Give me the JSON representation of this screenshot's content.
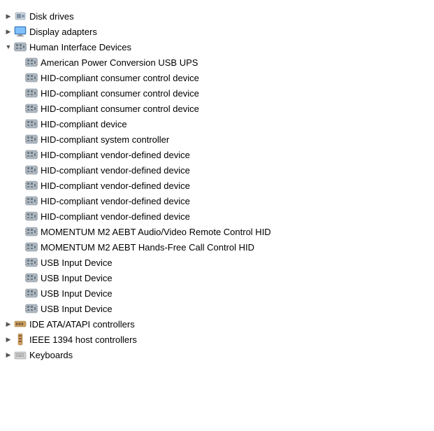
{
  "tree": {
    "items": [
      {
        "id": "disk-drives",
        "label": "Disk drives",
        "level": 0,
        "arrow": "right",
        "icon": "disk"
      },
      {
        "id": "display-adapters",
        "label": "Display adapters",
        "level": 0,
        "arrow": "right",
        "icon": "display"
      },
      {
        "id": "human-interface-devices",
        "label": "Human Interface Devices",
        "level": 0,
        "arrow": "down",
        "icon": "hid"
      },
      {
        "id": "apc-ups",
        "label": "American Power Conversion USB UPS",
        "level": 1,
        "arrow": "none",
        "icon": "hid"
      },
      {
        "id": "hid-consumer-1",
        "label": "HID-compliant consumer control device",
        "level": 1,
        "arrow": "none",
        "icon": "hid"
      },
      {
        "id": "hid-consumer-2",
        "label": "HID-compliant consumer control device",
        "level": 1,
        "arrow": "none",
        "icon": "hid"
      },
      {
        "id": "hid-consumer-3",
        "label": "HID-compliant consumer control device",
        "level": 1,
        "arrow": "none",
        "icon": "hid"
      },
      {
        "id": "hid-device",
        "label": "HID-compliant device",
        "level": 1,
        "arrow": "none",
        "icon": "hid"
      },
      {
        "id": "hid-system-controller",
        "label": "HID-compliant system controller",
        "level": 1,
        "arrow": "none",
        "icon": "hid"
      },
      {
        "id": "hid-vendor-1",
        "label": "HID-compliant vendor-defined device",
        "level": 1,
        "arrow": "none",
        "icon": "hid"
      },
      {
        "id": "hid-vendor-2",
        "label": "HID-compliant vendor-defined device",
        "level": 1,
        "arrow": "none",
        "icon": "hid"
      },
      {
        "id": "hid-vendor-3",
        "label": "HID-compliant vendor-defined device",
        "level": 1,
        "arrow": "none",
        "icon": "hid"
      },
      {
        "id": "hid-vendor-4",
        "label": "HID-compliant vendor-defined device",
        "level": 1,
        "arrow": "none",
        "icon": "hid"
      },
      {
        "id": "hid-vendor-5",
        "label": "HID-compliant vendor-defined device",
        "level": 1,
        "arrow": "none",
        "icon": "hid"
      },
      {
        "id": "momentum-audio",
        "label": "MOMENTUM M2 AEBT Audio/Video Remote Control HID",
        "level": 1,
        "arrow": "none",
        "icon": "hid"
      },
      {
        "id": "momentum-handsfree",
        "label": "MOMENTUM M2 AEBT Hands-Free Call Control HID",
        "level": 1,
        "arrow": "none",
        "icon": "hid"
      },
      {
        "id": "usb-input-1",
        "label": "USB Input Device",
        "level": 1,
        "arrow": "none",
        "icon": "hid"
      },
      {
        "id": "usb-input-2",
        "label": "USB Input Device",
        "level": 1,
        "arrow": "none",
        "icon": "hid"
      },
      {
        "id": "usb-input-3",
        "label": "USB Input Device",
        "level": 1,
        "arrow": "none",
        "icon": "hid"
      },
      {
        "id": "usb-input-4",
        "label": "USB Input Device",
        "level": 1,
        "arrow": "none",
        "icon": "hid"
      },
      {
        "id": "ide-controllers",
        "label": "IDE ATA/ATAPI controllers",
        "level": 0,
        "arrow": "right",
        "icon": "ide"
      },
      {
        "id": "ieee-1394",
        "label": "IEEE 1394 host controllers",
        "level": 0,
        "arrow": "right",
        "icon": "ieee"
      },
      {
        "id": "keyboards",
        "label": "Keyboards",
        "level": 0,
        "arrow": "right",
        "icon": "keyboard"
      }
    ]
  }
}
